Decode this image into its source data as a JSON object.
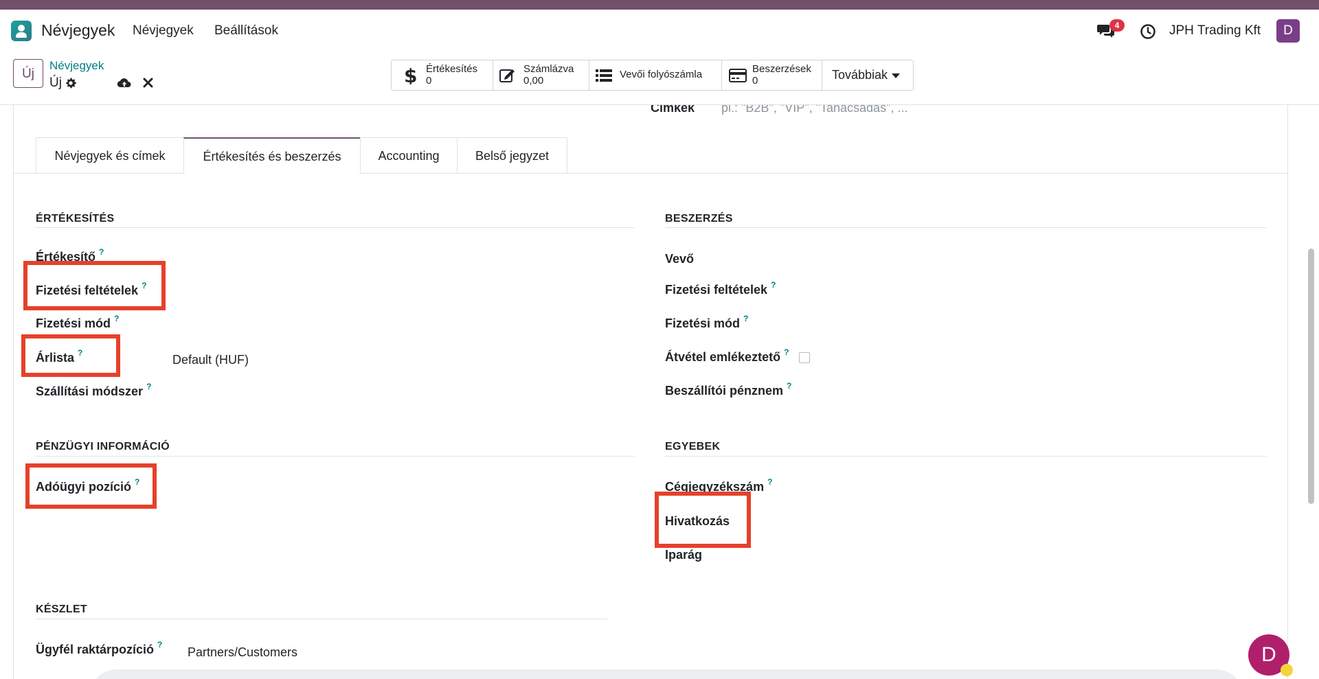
{
  "colors": {
    "brand": "#71506b",
    "link": "#017e84",
    "highlight": "#e5412b",
    "badge": "#dc3545"
  },
  "navbar": {
    "app_icon": "contacts-app-icon",
    "app_name": "Névjegyek",
    "menu": [
      "Névjegyek",
      "Beállítások"
    ],
    "chat_icon": "chat-bubbles-icon",
    "chat_badge": "4",
    "activity_icon": "clock-icon",
    "company": "JPH Trading Kft",
    "user_initial": "D"
  },
  "control_panel": {
    "new_button": "Új",
    "breadcrumb_parent": "Névjegyek",
    "breadcrumb_current": "Új",
    "actions": {
      "gear": "gear-icon",
      "save": "cloud-upload-icon",
      "discard": "close-icon"
    },
    "smart_buttons": [
      {
        "icon": "dollar-icon",
        "label": "Értékesítés",
        "value": "0"
      },
      {
        "icon": "edit-icon",
        "label": "Számlázva",
        "value": "0,00"
      },
      {
        "icon": "list-icon",
        "label": "Vevői folyószámla"
      },
      {
        "icon": "credit-card-icon",
        "label": "Beszerzések",
        "value": "0"
      }
    ],
    "more_label": "Továbbiak"
  },
  "form": {
    "tags_label": "Címkék",
    "tags_placeholder": "pl.: \"B2B\", \"VIP\", \"Tanácsadás\", ...",
    "tabs": [
      "Névjegyek és címek",
      "Értékesítés és beszerzés",
      "Accounting",
      "Belső jegyzet"
    ],
    "active_tab": "Értékesítés és beszerzés",
    "help_mark": "?",
    "sales": {
      "title": "ÉRTÉKESÍTÉS",
      "salesperson": "Értékesítő",
      "payment_terms": "Fizetési feltételek",
      "payment_method": "Fizetési mód",
      "pricelist": "Árlista",
      "pricelist_value": "Default (HUF)",
      "delivery_method": "Szállítási módszer"
    },
    "purchase": {
      "title": "BESZERZÉS",
      "buyer": "Vevő",
      "payment_terms": "Fizetési feltételek",
      "payment_method": "Fizetési mód",
      "receipt_reminder": "Átvétel emlékeztető",
      "supplier_currency": "Beszállítói pénznem"
    },
    "fiscal": {
      "title": "PÉNZÜGYI INFORMÁCIÓ",
      "fiscal_position": "Adóügyi pozíció"
    },
    "misc": {
      "title": "EGYEBEK",
      "company_registry": "Cégjegyzékszám",
      "reference": "Hivatkozás",
      "industry": "Iparág"
    },
    "inventory": {
      "title": "KÉSZLET",
      "customer_location": "Ügyfél raktárpozíció",
      "customer_location_value": "Partners/Customers"
    }
  },
  "fab_initial": "D"
}
